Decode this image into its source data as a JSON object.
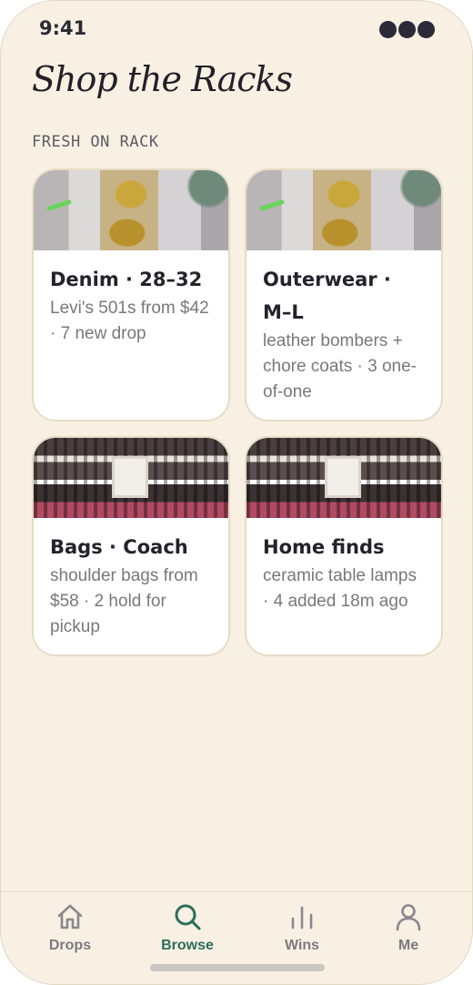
{
  "status": {
    "time": "9:41"
  },
  "header": {
    "title": "Shop the Racks"
  },
  "section": {
    "label": "FRESH ON RACK"
  },
  "cards": [
    {
      "title": "Denim · 28–32",
      "desc": "Levi's 501s from $42 · 7 new drop",
      "image": "gold-braid-trim"
    },
    {
      "title": "Outerwear · M–L",
      "desc": "leather bombers + chore coats · 3 one-of-one",
      "image": "gold-braid-trim"
    },
    {
      "title": "Bags · Coach",
      "desc": "shoulder bags from $58 · 2 hold for pickup",
      "image": "thrift-store-racks"
    },
    {
      "title": "Home finds",
      "desc": "ceramic table lamps · 4 added 18m ago",
      "image": "thrift-store-racks"
    }
  ],
  "tabs": [
    {
      "label": "Drops",
      "icon": "home-icon",
      "active": false
    },
    {
      "label": "Browse",
      "icon": "search-icon",
      "active": true
    },
    {
      "label": "Wins",
      "icon": "bar-chart-icon",
      "active": false
    },
    {
      "label": "Me",
      "icon": "person-icon",
      "active": false
    }
  ],
  "colors": {
    "accent": "#2c6e5a",
    "background": "#f7f0e3",
    "card_border": "#e6dcc7"
  }
}
